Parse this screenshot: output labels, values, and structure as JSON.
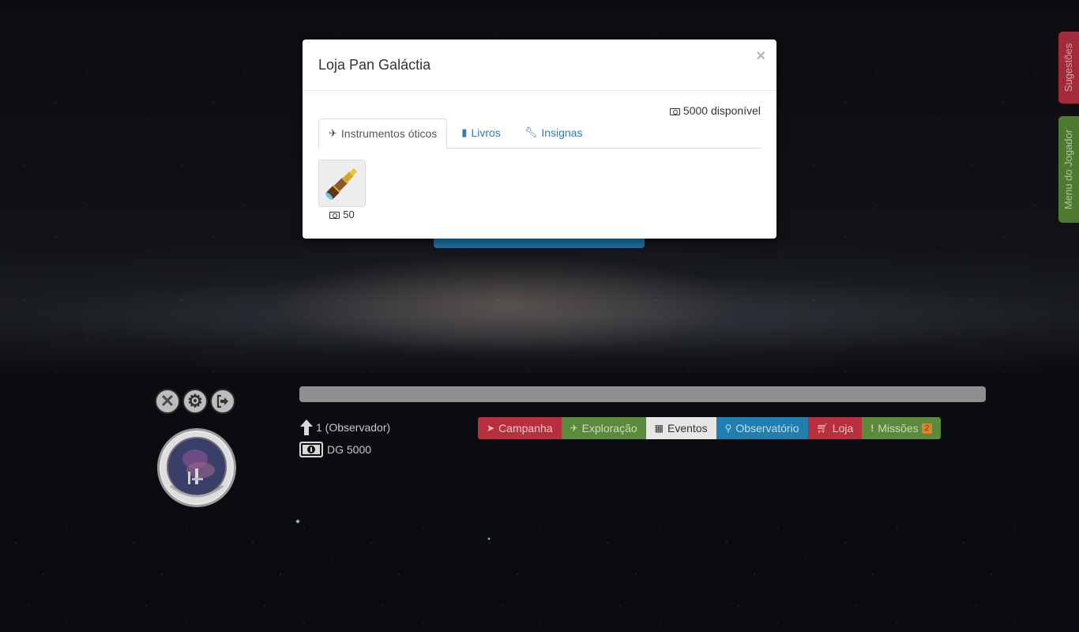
{
  "modal": {
    "title": "Loja Pan Galáctia",
    "close_label": "×",
    "balance": "5000 disponível",
    "tabs": [
      {
        "label": "Instrumentos óticos",
        "icon": "plane-icon",
        "active": true
      },
      {
        "label": "Livros",
        "icon": "book-icon",
        "active": false
      },
      {
        "label": "Insignas",
        "icon": "wrench-icon",
        "active": false
      }
    ],
    "items": [
      {
        "name": "spyglass",
        "icon": "spyglass-icon",
        "price": "50"
      }
    ]
  },
  "side_tabs": {
    "sugestoes": "Sugestões",
    "menu": "Menu do Jogador"
  },
  "player": {
    "level_text": "1 (Observador)",
    "currency_text": "DG 5000"
  },
  "nav": [
    {
      "label": "Campanha",
      "icon": "rocket-icon",
      "bg": "#b8303d",
      "fg": "#f1c5ca"
    },
    {
      "label": "Exploração",
      "icon": "plane-icon",
      "bg": "#5c8a3c",
      "fg": "#c9dcbc"
    },
    {
      "label": "Eventos",
      "icon": "calendar-icon",
      "bg": "#e6e6e6",
      "fg": "#333333"
    },
    {
      "label": "Observatório",
      "icon": "search-icon",
      "bg": "#1f7fb0",
      "fg": "#c3dcea"
    },
    {
      "label": "Loja",
      "icon": "cart-icon",
      "bg": "#b8303d",
      "fg": "#f1c5ca"
    },
    {
      "label": "Missões",
      "icon": "exclamation-icon",
      "bg": "#5c8a3c",
      "fg": "#c9dcbc",
      "badge": "2"
    }
  ]
}
